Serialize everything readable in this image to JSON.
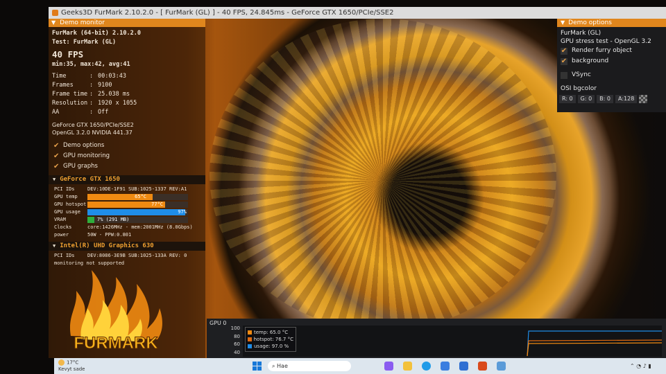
{
  "window": {
    "title": "Geeks3D FurMark 2.10.2.0 - [ FurMark (GL) ] - 40 FPS, 24.845ms - GeForce GTX 1650/PCIe/SSE2"
  },
  "demo_monitor": {
    "header": "Demo monitor",
    "app": "FurMark (64-bit) 2.10.2.0",
    "test": "Test: FurMark (GL)",
    "fps": "40 FPS",
    "fps_stats": "min:35, max:42, avg:41",
    "stats": [
      {
        "key": "Time",
        "value": "00:03:43"
      },
      {
        "key": "Frames",
        "value": "9100"
      },
      {
        "key": "Frame time",
        "value": "25.038 ms"
      },
      {
        "key": "Resolution",
        "value": "1920 x 1055"
      },
      {
        "key": "AA",
        "value": "Off"
      }
    ],
    "gpu_name": "GeForce GTX 1650/PCIe/SSE2",
    "opengl": "OpenGL 3.2.0 NVIDIA 441.37",
    "checks": [
      {
        "label": "Demo options",
        "checked": true
      },
      {
        "label": "GPU monitoring",
        "checked": true
      },
      {
        "label": "GPU graphs",
        "checked": true
      }
    ]
  },
  "gpu1": {
    "header": "GeForce GTX 1650",
    "pci_label": "PCI IDs",
    "pci": "DEV:10DE-1F91 SUB:1025-1337 REV:A1",
    "metrics": [
      {
        "label": "GPU temp",
        "text": "65°C",
        "level": 0.65,
        "color": "#f08a12"
      },
      {
        "label": "GPU hotspot",
        "text": "77°C",
        "level": 0.77,
        "color": "#f08a12"
      },
      {
        "label": "GPU usage",
        "text": "97%",
        "level": 0.97,
        "color": "#1f8de8"
      },
      {
        "label": "VRAM",
        "text": "7% (291 MB)",
        "level": 0.07,
        "color": "#2fae3c"
      }
    ],
    "clocks_label": "Clocks",
    "clocks": "core:1426MHz - mem:2001MHz (8.0Gbps)",
    "power_label": "power",
    "power": "50W - PPW:0.801"
  },
  "gpu2": {
    "header": "Intel(R) UHD Graphics 630",
    "pci_label": "PCI IDs",
    "pci": "DEV:8086-3E9B SUB:1025-133A REV: 0",
    "note": "monitoring not supported"
  },
  "logo_text": "FURMARK",
  "demo_options": {
    "header": "Demo options",
    "name": "FurMark (GL)",
    "desc": "GPU stress test - OpenGL 3.2",
    "render_furry": "Render furry object",
    "background": "background",
    "vsync": "VSync",
    "osi_bgcolor": "OSI bgcolor",
    "r": "R: 0",
    "g": "G: 0",
    "b": "B: 0",
    "a": "A:128"
  },
  "graph": {
    "label": "GPU 0",
    "ticks": [
      "100",
      "80",
      "60",
      "40"
    ],
    "legend": [
      {
        "text": "temp: 65.0 °C",
        "color": "#f08a12"
      },
      {
        "text": "hotspot: 76.7 °C",
        "color": "#e06a10"
      },
      {
        "text": "usage: 97.0 %",
        "color": "#1f8de8"
      }
    ]
  },
  "taskbar": {
    "weather_temp": "17°C",
    "weather_desc": "Kevyt sade",
    "search": "Hae"
  }
}
